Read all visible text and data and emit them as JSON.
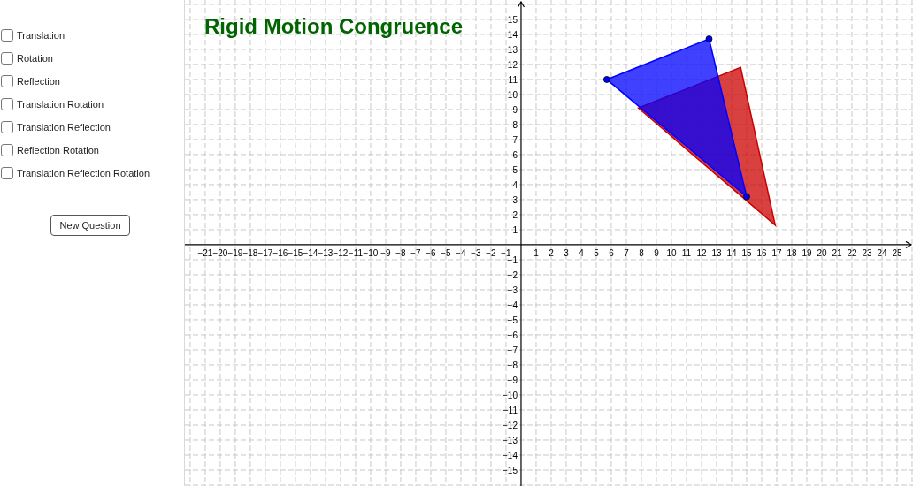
{
  "sidebar": {
    "checkboxes": [
      {
        "label": "Translation",
        "checked": false
      },
      {
        "label": "Rotation",
        "checked": false
      },
      {
        "label": "Reflection",
        "checked": false
      },
      {
        "label": "Translation Rotation",
        "checked": false
      },
      {
        "label": "Translation Reflection",
        "checked": false
      },
      {
        "label": "Reflection Rotation",
        "checked": false
      },
      {
        "label": "Translation Reflection Rotation",
        "checked": false
      }
    ],
    "button": "New Question"
  },
  "graph": {
    "chart_data": {
      "type": "area",
      "title": "Rigid Motion Congruence",
      "xlim": [
        -22.35,
        26.06
      ],
      "ylim": [
        -16.06,
        16.29
      ],
      "xticks": [
        {
          "value": -21,
          "label": "−21"
        },
        {
          "value": -20,
          "label": "−20"
        },
        {
          "value": -19,
          "label": "−19"
        },
        {
          "value": -18,
          "label": "−18"
        },
        {
          "value": -17,
          "label": "−17"
        },
        {
          "value": -16,
          "label": "−16"
        },
        {
          "value": -15,
          "label": "−15"
        },
        {
          "value": -14,
          "label": "−14"
        },
        {
          "value": -13,
          "label": "−13"
        },
        {
          "value": -12,
          "label": "−12"
        },
        {
          "value": -11,
          "label": "−11"
        },
        {
          "value": -10,
          "label": "−10"
        },
        {
          "value": -9,
          "label": "−9"
        },
        {
          "value": -8,
          "label": "−8"
        },
        {
          "value": -7,
          "label": "−7"
        },
        {
          "value": -6,
          "label": "−6"
        },
        {
          "value": -5,
          "label": "−5"
        },
        {
          "value": -4,
          "label": "−4"
        },
        {
          "value": -3,
          "label": "−3"
        },
        {
          "value": -2,
          "label": "−2"
        },
        {
          "value": -1,
          "label": "−1"
        },
        1,
        2,
        3,
        4,
        5,
        6,
        7,
        8,
        9,
        10,
        11,
        12,
        13,
        14,
        15,
        16,
        17,
        18,
        19,
        20,
        21,
        22,
        23,
        24,
        25
      ],
      "yticks": [
        {
          "value": -15,
          "label": "−15"
        },
        {
          "value": -14,
          "label": "−14"
        },
        {
          "value": -13,
          "label": "−13"
        },
        {
          "value": -12,
          "label": "−12"
        },
        {
          "value": -11,
          "label": "−11"
        },
        {
          "value": -10,
          "label": "−10"
        },
        {
          "value": -9,
          "label": "−9"
        },
        {
          "value": -8,
          "label": "−8"
        },
        {
          "value": -7,
          "label": "−7"
        },
        {
          "value": -6,
          "label": "−6"
        },
        {
          "value": -5,
          "label": "−5"
        },
        {
          "value": -4,
          "label": "−4"
        },
        {
          "value": -3,
          "label": "−3"
        },
        {
          "value": -2,
          "label": "−2"
        },
        {
          "value": -1,
          "label": "−1"
        },
        1,
        2,
        3,
        4,
        5,
        6,
        7,
        8,
        9,
        10,
        11,
        12,
        13,
        14,
        15
      ],
      "series": [
        {
          "color": "#cc0000",
          "x": [
            7.8,
            14.6,
            16.9
          ],
          "values": [
            9.1,
            11.8,
            1.3
          ]
        },
        {
          "color": "#0000ff",
          "x": [
            5.7,
            12.5,
            15
          ],
          "values": [
            11,
            13.7,
            3.2
          ]
        },
        {
          "type": "scatter",
          "color": "#0000ff",
          "x": [
            5.7,
            12.5,
            15
          ],
          "values": [
            11,
            13.7,
            3.2
          ]
        }
      ],
      "grid": true
    }
  }
}
